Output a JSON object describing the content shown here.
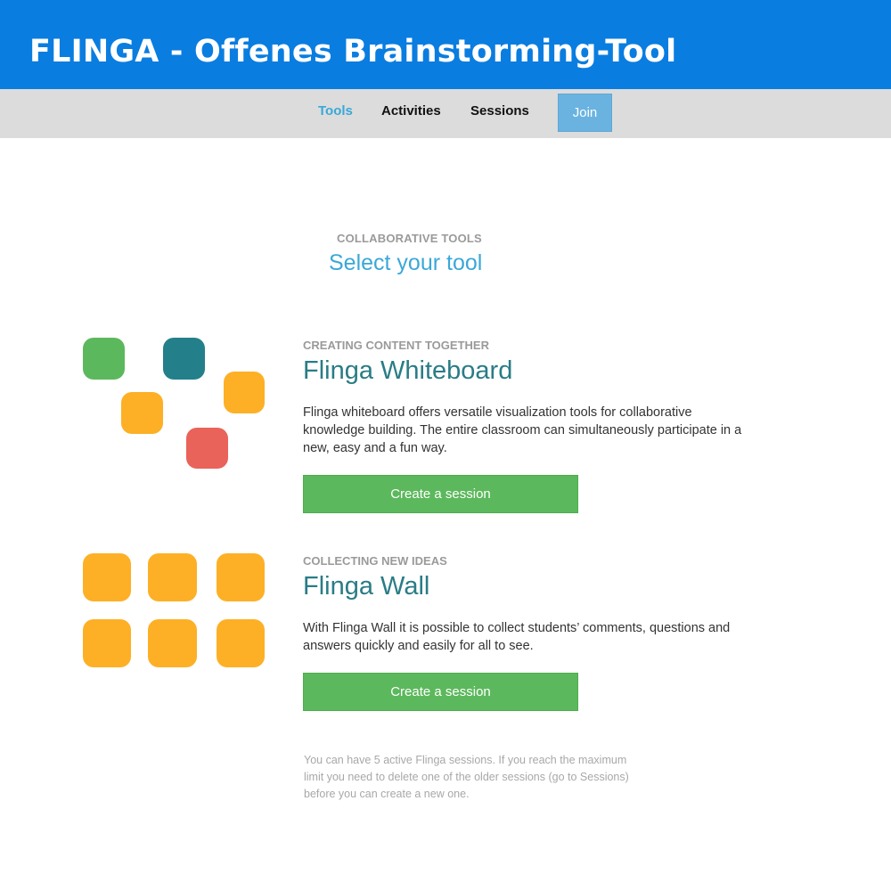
{
  "header": {
    "title": "FLINGA - Offenes Brainstorming-Tool"
  },
  "nav": {
    "tools": "Tools",
    "activities": "Activities",
    "sessions": "Sessions",
    "join": "Join"
  },
  "colors": {
    "banner": "#0a7de0",
    "nav_active": "#3aa8d8",
    "heading_teal": "#2a7c86",
    "button_green": "#5cb85c",
    "tile_green": "#5cb85c",
    "tile_teal": "#23808a",
    "tile_orange": "#fdb026",
    "tile_red": "#e9635a"
  },
  "intro": {
    "kicker": "COLLABORATIVE TOOLS",
    "title": "Select your tool"
  },
  "tools": [
    {
      "kicker": "CREATING CONTENT TOGETHER",
      "title": "Flinga Whiteboard",
      "description": "Flinga whiteboard offers versatile visualization tools for collaborative knowledge building. The entire classroom can simultaneously participate in a new, easy and a fun way.",
      "button": "Create a session"
    },
    {
      "kicker": "COLLECTING NEW IDEAS",
      "title": "Flinga Wall",
      "description": "With Flinga Wall it is possible to collect students’ comments, questions and answers quickly and easily for all to see.",
      "button": "Create a session"
    }
  ],
  "footnote": "You can have 5 active Flinga sessions. If you reach the maximum limit you need to delete one of the older sessions (go to Sessions) before you can create a new one."
}
